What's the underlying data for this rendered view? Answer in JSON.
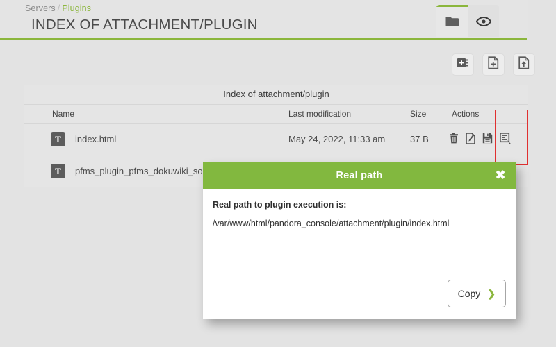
{
  "header": {
    "breadcrumb": {
      "parent": "Servers",
      "separator": "/",
      "current": "Plugins"
    },
    "title": "INDEX OF ATTACHMENT/PLUGIN",
    "tabs": [
      {
        "name": "folder-icon",
        "label": "Folder",
        "active": true
      },
      {
        "name": "eye-icon",
        "label": "View",
        "active": false
      }
    ],
    "accent_color": "#8bb63c"
  },
  "toolbar": {
    "buttons": [
      {
        "name": "create-directory-icon",
        "label": "Create directory"
      },
      {
        "name": "create-file-icon",
        "label": "Create file"
      },
      {
        "name": "upload-file-icon",
        "label": "Upload file"
      }
    ]
  },
  "table": {
    "caption": "Index of attachment/plugin",
    "columns": [
      "Name",
      "Last modification",
      "Size",
      "Actions"
    ],
    "rows": [
      {
        "icon": "text-file-icon",
        "icon_letter": "T",
        "name": "index.html",
        "last_modification": "May 24, 2022, 11:33 am",
        "size": "37 B",
        "actions": [
          "delete-icon",
          "edit-icon",
          "save-icon",
          "real-path-icon"
        ]
      },
      {
        "icon": "text-file-icon",
        "icon_letter": "T",
        "name": "pfms_plugin_pfms_dokuwiki_source_code.",
        "last_modification": "",
        "size": "",
        "actions": []
      }
    ]
  },
  "annotation": {
    "name": "highlight-box",
    "color": "#e03030"
  },
  "modal": {
    "title": "Real path",
    "close_label": "✖",
    "label": "Real path to plugin execution is:",
    "path": "/var/www/html/pandora_console/attachment/plugin/index.html",
    "copy_label": "Copy",
    "copy_chevron": "❯",
    "header_color": "#82b83f"
  }
}
